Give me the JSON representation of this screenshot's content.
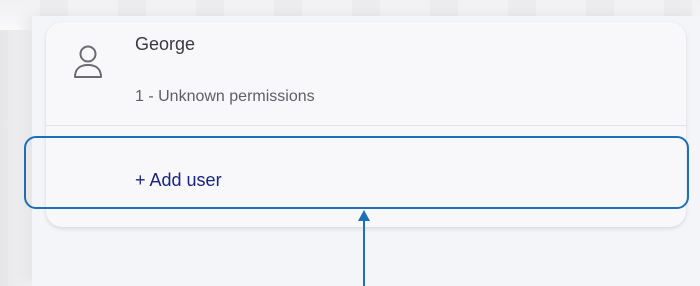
{
  "user": {
    "name": "George",
    "permissions": "1 - Unknown permissions",
    "icon": "user-icon"
  },
  "actions": {
    "add_user_label": "+ Add user"
  },
  "colors": {
    "highlight": "#1d6fb8",
    "link": "#1a237e"
  }
}
